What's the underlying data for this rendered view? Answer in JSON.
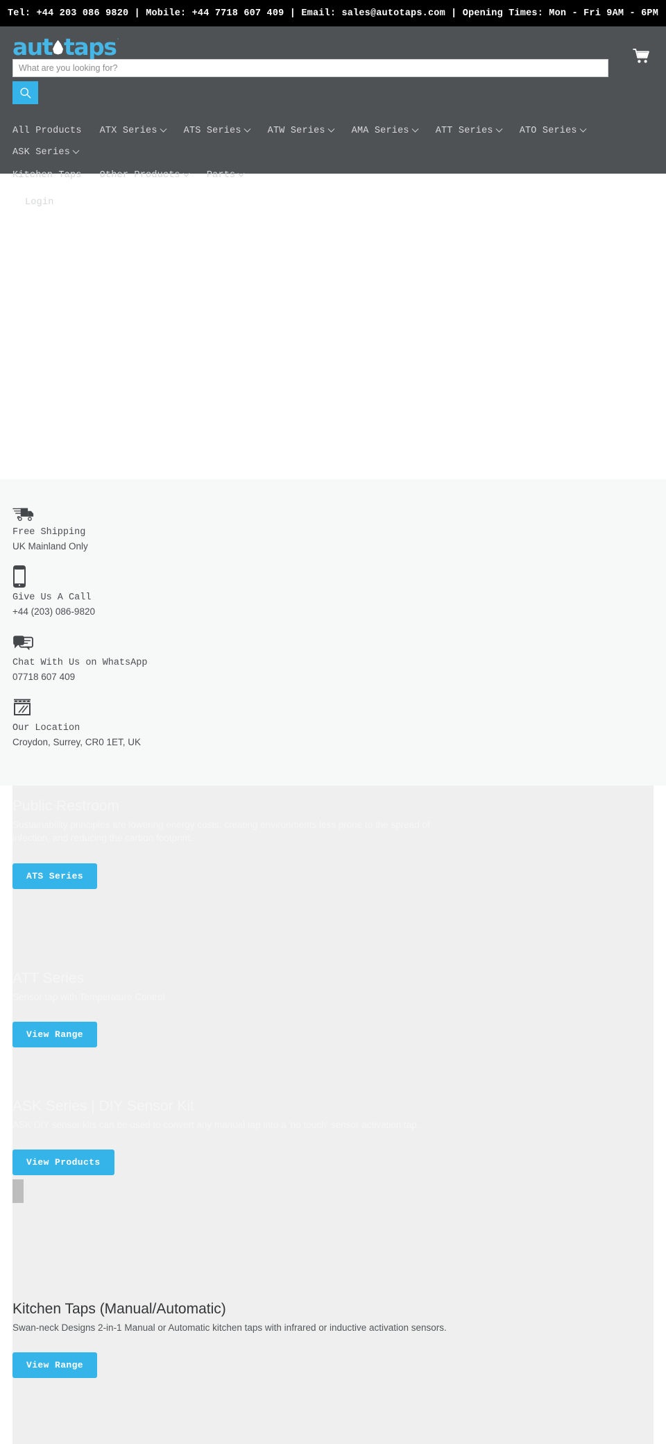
{
  "announcement": {
    "text": "Tel: +44 203 086 9820 | Mobile: +44 7718 607 409 | Email: sales@autotaps.com | Opening Times: Mon - Fri 9AM - 6PM"
  },
  "header": {
    "logo_part1": "aut",
    "logo_part2": "taps",
    "logo_tm": "·",
    "search": {
      "placeholder": "What are you looking for?",
      "value": "",
      "button_icon": "search-icon"
    },
    "cart_icon": "shopping-cart-icon"
  },
  "nav": {
    "row1": [
      {
        "label": "All Products",
        "has_dropdown": false
      },
      {
        "label": "ATX Series",
        "has_dropdown": true
      },
      {
        "label": "ATS Series",
        "has_dropdown": true
      },
      {
        "label": "ATW Series",
        "has_dropdown": true
      },
      {
        "label": "AMA Series",
        "has_dropdown": true
      },
      {
        "label": "ATT Series",
        "has_dropdown": true
      },
      {
        "label": "ATO Series",
        "has_dropdown": true
      },
      {
        "label": "ASK Series",
        "has_dropdown": true
      }
    ],
    "row2": [
      {
        "label": "Kitchen Taps",
        "has_dropdown": false
      },
      {
        "label": "Other Products",
        "has_dropdown": true
      },
      {
        "label": "Parts",
        "has_dropdown": true
      }
    ],
    "row3": [
      {
        "label": "Login",
        "has_dropdown": false
      }
    ]
  },
  "features": [
    {
      "icon": "delivery-truck-icon",
      "title": "Free Shipping",
      "sub": "UK Mainland Only"
    },
    {
      "icon": "mobile-phone-icon",
      "title": "Give Us A Call",
      "sub": "+44 (203) 086-9820"
    },
    {
      "icon": "chat-bubbles-icon",
      "title": "Chat With Us on WhatsApp",
      "sub": "07718 607 409"
    },
    {
      "icon": "storefront-icon",
      "title": "Our Location",
      "sub": "Croydon, Surrey, CR0 1ET, UK"
    }
  ],
  "promos": [
    {
      "title": "Public Restroom",
      "desc": "Sustainability principles are lowering energy costs, creating environments less prone to the spread of infection, and reducing the carbon footprint.",
      "button": "ATS Series"
    },
    {
      "title": "ATT Series",
      "desc": "Sensor tap with Temperature Control",
      "button": "View Range"
    },
    {
      "title": "ASK Series | DIY Sensor Kit",
      "desc": "ASK DIY sensor kits can be used to convert any manual tap into a 'no touch' sensor activation tap.",
      "button": "View Products"
    },
    {
      "title": "Kitchen Taps (Manual/Automatic)",
      "desc": "Swan-neck Designs 2-in-1 Manual or Automatic kitchen taps with infrared or inductive activation sensors.",
      "button": "View Range"
    }
  ],
  "colors": {
    "accent_blue": "#35b4ea",
    "header_grey": "#4e5255",
    "announce_black": "#000000",
    "promo_grey": "#efefef"
  }
}
